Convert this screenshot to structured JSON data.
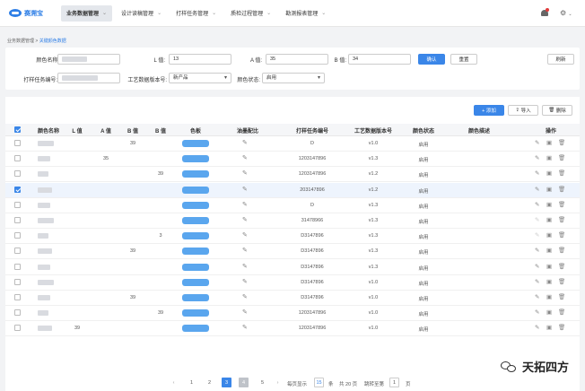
{
  "app": {
    "logo_text": "赛溯宝"
  },
  "nav": [
    {
      "label": "业务数据管理",
      "active": true
    },
    {
      "label": "设计读稿管理",
      "active": false
    },
    {
      "label": "打样任务管理",
      "active": false
    },
    {
      "label": "质检过程管理",
      "active": false
    },
    {
      "label": "勘测报表管理",
      "active": false
    }
  ],
  "breadcrumb": {
    "parent": "业务数据管理",
    "current": "关键颜色数据"
  },
  "filters": {
    "color_name_label": "颜色名称:",
    "l_label": "L 值:",
    "l_value": "13",
    "a_label": "A 值:",
    "a_value": "35",
    "b_label": "B 值:",
    "b_value": "34",
    "query_btn": "确认",
    "reset_btn": "重置",
    "refresh_btn": "刷新",
    "task_label": "打样任务编号:",
    "version_label": "工艺数据版本号:",
    "version_value": "新产品",
    "status_label": "颜色状态:",
    "status_value": "启用"
  },
  "toolbar": {
    "add": "+ 添加",
    "import": "导入",
    "delete": "删除"
  },
  "table": {
    "headers": [
      "颜色名称",
      "L 值",
      "A 值",
      "B 值",
      "B 值",
      "色板",
      "油墨配比",
      "打样任务编号",
      "工艺数据版本号",
      "颜色状态",
      "颜色描述",
      "操作"
    ],
    "rows": [
      {
        "l": "",
        "a": "",
        "b1": "39",
        "b2": "",
        "task": "D",
        "ver": "v1.0",
        "status": "启用",
        "checked": false,
        "disabled": false
      },
      {
        "l": "",
        "a": "35",
        "b1": "",
        "b2": "",
        "task": "1203147896",
        "ver": "v1.3",
        "status": "启用",
        "checked": false,
        "disabled": false
      },
      {
        "l": "",
        "a": "",
        "b1": "",
        "b2": "39",
        "task": "1203147896",
        "ver": "v1.2",
        "status": "启用",
        "checked": false,
        "disabled": false
      },
      {
        "l": "",
        "a": "",
        "b1": "",
        "b2": "",
        "task": "203147896",
        "ver": "v1.2",
        "status": "启用",
        "checked": true,
        "disabled": false
      },
      {
        "l": "",
        "a": "",
        "b1": "",
        "b2": "",
        "task": "D",
        "ver": "v1.3",
        "status": "启用",
        "checked": false,
        "disabled": false
      },
      {
        "l": "",
        "a": "",
        "b1": "",
        "b2": "",
        "task": "31478966",
        "ver": "v1.3",
        "status": "启用",
        "checked": false,
        "disabled": true
      },
      {
        "l": "",
        "a": "",
        "b1": "",
        "b2": "3",
        "task": "D3147896",
        "ver": "v1.3",
        "status": "启用",
        "checked": false,
        "disabled": true
      },
      {
        "l": "",
        "a": "",
        "b1": "39",
        "b2": "",
        "task": "D3147896",
        "ver": "v1.3",
        "status": "启用",
        "checked": false,
        "disabled": false
      },
      {
        "l": "",
        "a": "",
        "b1": "",
        "b2": "",
        "task": "D3147896",
        "ver": "v1.3",
        "status": "启用",
        "checked": false,
        "disabled": false
      },
      {
        "l": "",
        "a": "",
        "b1": "",
        "b2": "",
        "task": "D3147896",
        "ver": "v1.0",
        "status": "启用",
        "checked": false,
        "disabled": false
      },
      {
        "l": "",
        "a": "",
        "b1": "39",
        "b2": "",
        "task": "D3147896",
        "ver": "v1.0",
        "status": "启用",
        "checked": false,
        "disabled": false
      },
      {
        "l": "",
        "a": "",
        "b1": "",
        "b2": "39",
        "task": "1203147896",
        "ver": "v1.0",
        "status": "启用",
        "checked": false,
        "disabled": false
      },
      {
        "l": "39",
        "a": "",
        "b1": "",
        "b2": "",
        "task": "1203147896",
        "ver": "v1.0",
        "status": "启用",
        "checked": false,
        "disabled": false
      }
    ]
  },
  "pager": {
    "pages": [
      "1",
      "2",
      "3",
      "4",
      "5"
    ],
    "active": "3",
    "size_label": "每页显示",
    "size_value": "15",
    "size_unit": "条",
    "total": "共 20 页",
    "jump_label": "跳转至第",
    "jump_value": "1",
    "jump_unit": "页"
  },
  "watermark": {
    "text": "天拓四方"
  }
}
